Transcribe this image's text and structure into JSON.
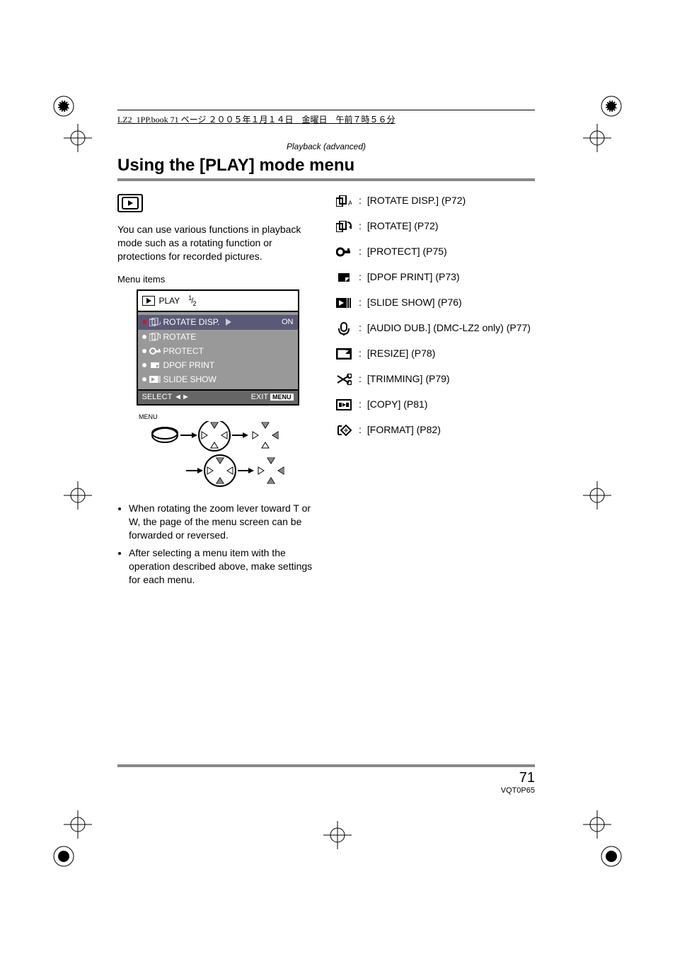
{
  "topbar": "LZ2_1PP.book  71 ページ  ２００５年１月１４日　金曜日　午前７時５６分",
  "section_header": "Playback (advanced)",
  "title": "Using the [PLAY] mode menu",
  "intro": "You can use various functions in playback mode such as a rotating function or protections for recorded pictures.",
  "menu_items_label": "Menu items",
  "menu": {
    "title": "PLAY",
    "page_num": "1",
    "page_total": "2",
    "rows": [
      {
        "label": "ROTATE DISP.",
        "value": "ON",
        "selected": true
      },
      {
        "label": "ROTATE",
        "value": "",
        "selected": false
      },
      {
        "label": "PROTECT",
        "value": "",
        "selected": false
      },
      {
        "label": "DPOF PRINT",
        "value": "",
        "selected": false
      },
      {
        "label": "SLIDE SHOW",
        "value": "",
        "selected": false
      }
    ],
    "foot_left": "SELECT",
    "foot_right": "EXIT",
    "foot_menu": "MENU",
    "nav_label": "MENU"
  },
  "notes": [
    "When rotating the zoom lever toward T or W, the page of the menu screen can be forwarded or reversed.",
    "After selecting a menu item with the operation described above, make settings for each menu."
  ],
  "rlist": [
    {
      "label": "[ROTATE DISP.] (P72)"
    },
    {
      "label": "[ROTATE] (P72)"
    },
    {
      "label": "[PROTECT] (P75)"
    },
    {
      "label": "[DPOF PRINT] (P73)"
    },
    {
      "label": "[SLIDE SHOW] (P76)"
    },
    {
      "label": "[AUDIO DUB.] (DMC-LZ2 only) (P77)"
    },
    {
      "label": "[RESIZE] (P78)"
    },
    {
      "label": "[TRIMMING] (P79)"
    },
    {
      "label": "[COPY] (P81)"
    },
    {
      "label": "[FORMAT] (P82)"
    }
  ],
  "page_number": "71",
  "page_code": "VQT0P65"
}
